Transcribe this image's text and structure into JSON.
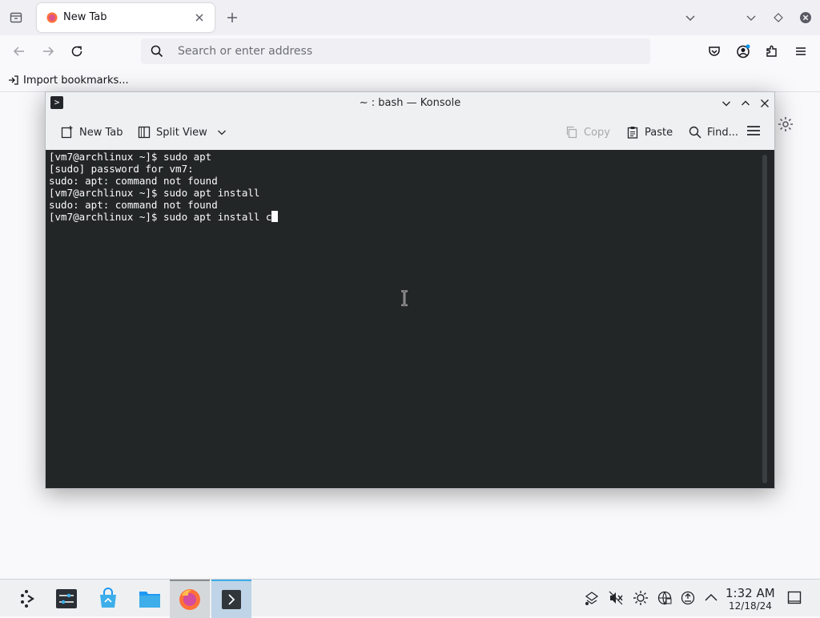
{
  "browser": {
    "tab_title": "New Tab",
    "url_placeholder": "Search or enter address",
    "bookmarks_import_label": "Import bookmarks..."
  },
  "konsole": {
    "window_title": "~ : bash — Konsole",
    "toolbar": {
      "new_tab_label": "New Tab",
      "split_view_label": "Split View",
      "copy_label": "Copy",
      "paste_label": "Paste",
      "find_label": "Find..."
    },
    "terminal_lines": [
      "[vm7@archlinux ~]$ sudo apt",
      "[sudo] password for vm7:",
      "sudo: apt: command not found",
      "[vm7@archlinux ~]$ sudo apt install",
      "sudo: apt: command not found",
      "[vm7@archlinux ~]$ sudo apt install c"
    ],
    "colors": {
      "terminal_bg": "#232627",
      "terminal_fg": "#fcfcfc",
      "accent": "#3daee9"
    }
  },
  "panel": {
    "clock_time": "1:32 AM",
    "clock_date": "12/18/24",
    "taskbar_icons": [
      "launcher-icon",
      "system-settings-icon",
      "discover-icon",
      "files-icon",
      "firefox-icon",
      "konsole-icon"
    ],
    "tray_icons": [
      "network-icon",
      "volume-muted-icon",
      "brightness-icon",
      "network-globe-icon",
      "updates-icon",
      "expand-tray-icon"
    ]
  }
}
